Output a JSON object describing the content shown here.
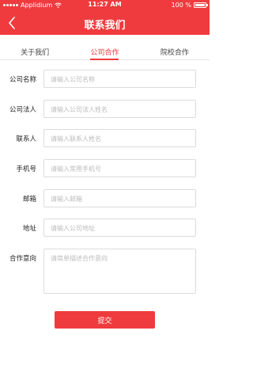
{
  "status_bar": {
    "carrier": "Applidium",
    "time": "11:27 AM",
    "battery_text": "100 %",
    "battery_level": 1.0
  },
  "nav": {
    "title": "联系我们",
    "back_icon": "chevron-left-icon"
  },
  "tabs": [
    {
      "label": "关于我们",
      "active": false
    },
    {
      "label": "公司合作",
      "active": true
    },
    {
      "label": "院校合作",
      "active": false
    }
  ],
  "form": {
    "fields": [
      {
        "label": "公司名称",
        "placeholder": "请输入公司名称"
      },
      {
        "label": "公司法人",
        "placeholder": "请输入公司法人姓名"
      },
      {
        "label": "联系人",
        "placeholder": "请输入联系人姓名"
      },
      {
        "label": "手机号",
        "placeholder": "请输入常用手机号"
      },
      {
        "label": "邮箱",
        "placeholder": "请输入邮箱"
      },
      {
        "label": "地址",
        "placeholder": "请输入公司地址"
      },
      {
        "label": "合作意向",
        "placeholder": "请简单描述合作意向"
      }
    ],
    "submit_label": "提交"
  },
  "colors": {
    "accent": "#ef3b3e",
    "border": "#dcdcdc",
    "placeholder": "#bbbbbb"
  }
}
